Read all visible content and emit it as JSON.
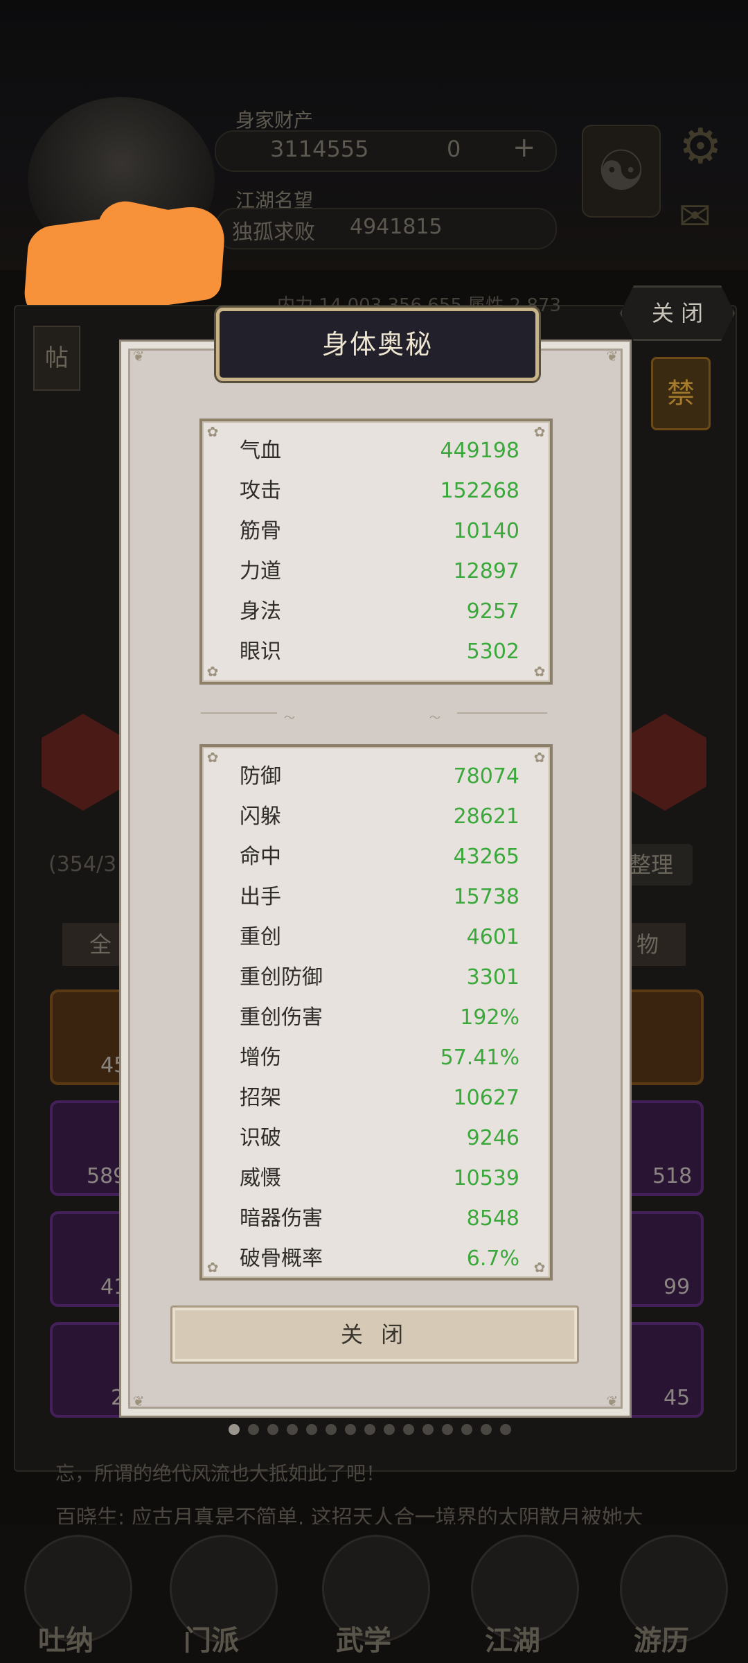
{
  "background": {
    "wealth_label": "身家财产",
    "coins": "3114555",
    "gems": "0",
    "fame_label": "江湖名望",
    "fame_title": "独孤求败",
    "fame_value": "4941815",
    "close_label": "关 闭",
    "stat_line": "内力 14,003,356,655  属性 2,873",
    "tie_label": "帖",
    "seal_label": "禁",
    "inventory_count": "(354/3",
    "sort_label": "整理",
    "filter_left": "全",
    "filter_right": "物",
    "item_counts": [
      "45",
      "589",
      "41",
      "2",
      "518",
      "99",
      "45"
    ],
    "chat_line1": "忘，所谓的绝代风流也大抵如此了吧！",
    "chat_line2": "百晓生: 应古月真是不简单, 这招天人合一境界的太阴散月被她大",
    "nav": [
      "吐纳",
      "门派",
      "武学",
      "江湖",
      "游历"
    ]
  },
  "modal": {
    "title": "身体奥秘",
    "primary_stats": [
      {
        "label": "气血",
        "value": "449198"
      },
      {
        "label": "攻击",
        "value": "152268"
      },
      {
        "label": "筋骨",
        "value": "10140"
      },
      {
        "label": "力道",
        "value": "12897"
      },
      {
        "label": "身法",
        "value": "9257"
      },
      {
        "label": "眼识",
        "value": "5302"
      }
    ],
    "secondary_stats": [
      {
        "label": "防御",
        "value": "78074"
      },
      {
        "label": "闪躲",
        "value": "28621"
      },
      {
        "label": "命中",
        "value": "43265"
      },
      {
        "label": "出手",
        "value": "15738"
      },
      {
        "label": "重创",
        "value": "4601"
      },
      {
        "label": "重创防御",
        "value": "3301"
      },
      {
        "label": "重创伤害",
        "value": "192%"
      },
      {
        "label": "增伤",
        "value": "57.41%"
      },
      {
        "label": "招架",
        "value": "10627"
      },
      {
        "label": "识破",
        "value": "9246"
      },
      {
        "label": "威慑",
        "value": "10539"
      },
      {
        "label": "暗器伤害",
        "value": "8548"
      },
      {
        "label": "破骨概率",
        "value": "6.7%"
      }
    ],
    "close_label": "关 闭"
  },
  "pagination": {
    "total": 15,
    "active": 0
  },
  "colors": {
    "stat_value": "#3aa83a",
    "modal_bg": "#d3ccc6",
    "title_bg": "#22202a"
  }
}
